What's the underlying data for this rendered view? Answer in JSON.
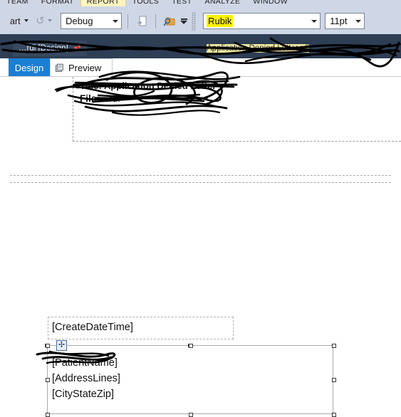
{
  "window": {
    "app": "report-designer",
    "accent_blue": "#1a7fd4",
    "toolbar_bg": "#cfd6e5",
    "tabwell_bg": "#2d3e55",
    "highlight_yellow": "#fff200",
    "redaction_highlight": "#f2e9a0"
  },
  "menubar": {
    "items": [
      {
        "label": "TEAM",
        "active": false
      },
      {
        "label": "FORMAT",
        "active": false
      },
      {
        "label": "REPORT",
        "active": true
      },
      {
        "label": "TOOLS",
        "active": false
      },
      {
        "label": "TEST",
        "active": false
      },
      {
        "label": "ANALYZE",
        "active": false
      },
      {
        "label": "WINDOW",
        "active": false
      }
    ]
  },
  "toolbar": {
    "start_label": "art",
    "start_caret_icon": "chevron-down-icon",
    "refresh_icon": "refresh-icon",
    "refresh_caret_icon": "chevron-down-icon",
    "config_combo": {
      "value": "Debug",
      "arrow_icon": "chevron-down-icon"
    },
    "step_icon": "step-into-icon",
    "find_icon": "find-in-files-icon",
    "overflow_icon": "toolbar-overflow-icon",
    "font_combo": {
      "value": "Rubik",
      "highlighted": true,
      "arrow_icon": "chevron-down-icon"
    },
    "size_combo": {
      "value": "11pt",
      "arrow_icon": "chevron-down-icon"
    }
  },
  "document_tabs": {
    "active": {
      "label": "…rdl [Design]",
      "pin_icon": "pin-icon",
      "redacted": true
    },
    "inactive": {
      "label": "Application Denied Letter.rdl",
      "redacted": true
    }
  },
  "view_tabs": [
    {
      "id": "design",
      "label": "Design",
      "selected": true,
      "icon": null
    },
    {
      "id": "preview",
      "label": "Preview",
      "selected": false,
      "icon": "preview-icon"
    }
  ],
  "report": {
    "title_line": "Title: Application Denied Letter",
    "file_label": "File:",
    "file_name": "…rdl",
    "textboxes": [
      {
        "name": "create-date-time",
        "lines": [
          "[CreateDateTime]"
        ],
        "selected": false
      },
      {
        "name": "address-block",
        "lines": [
          "[PatientName]",
          "[AddressLines]",
          "[CityStateZip]"
        ],
        "selected": true,
        "move_handle_icon": "move-handle-icon"
      }
    ]
  }
}
